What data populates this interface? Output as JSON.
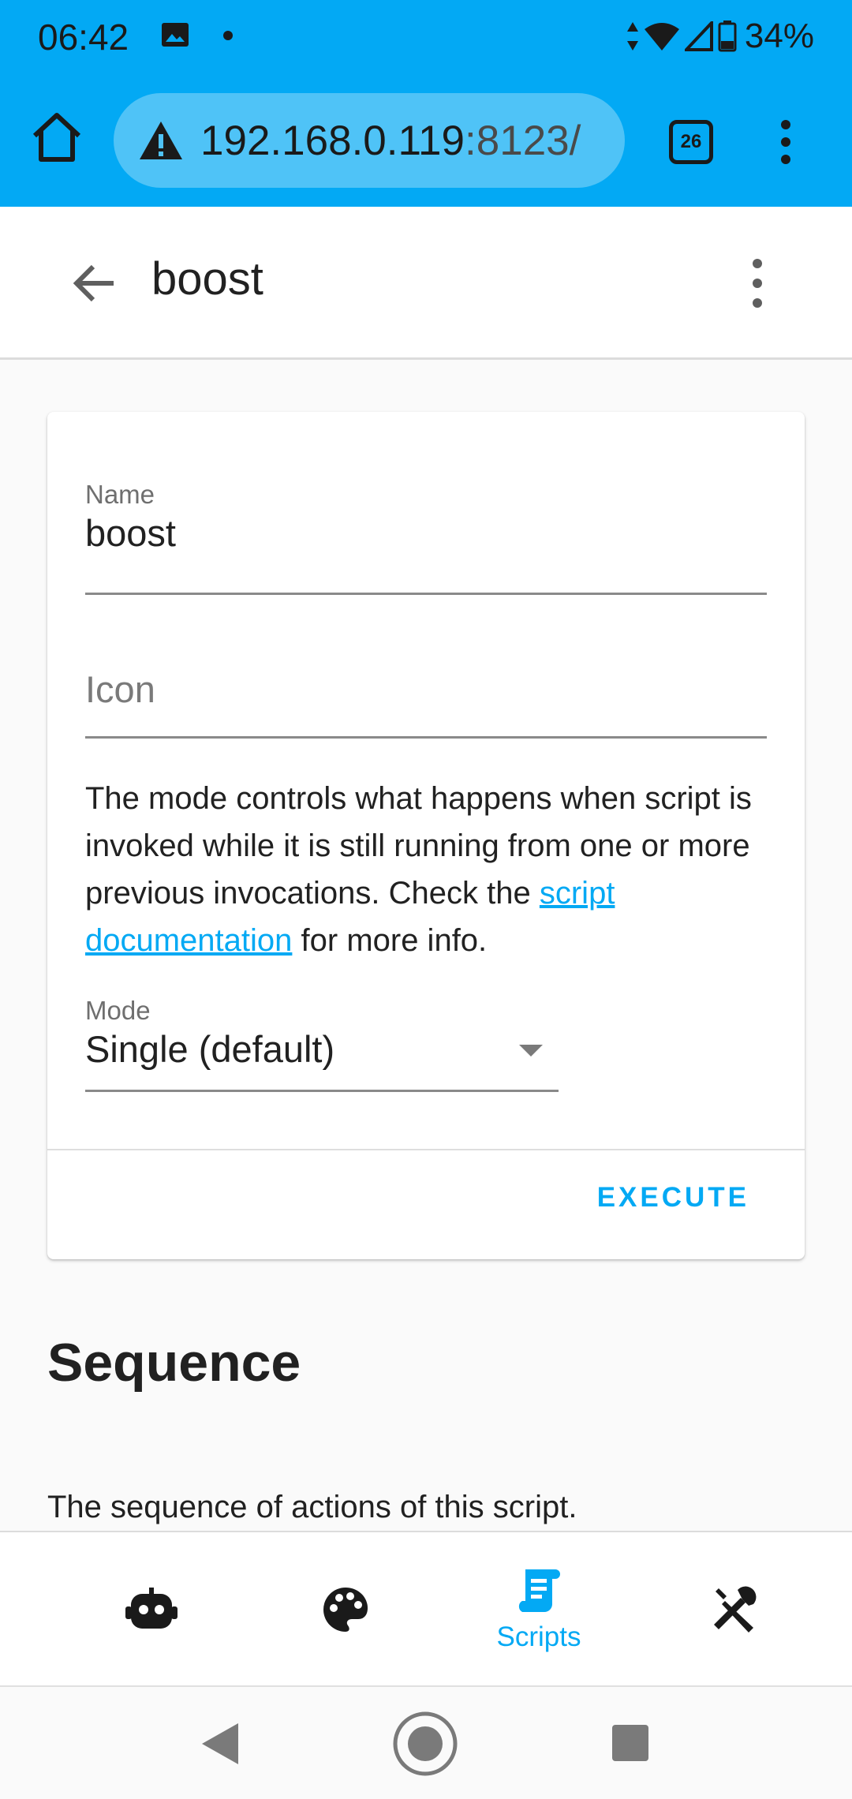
{
  "status_bar": {
    "time": "06:42",
    "battery": "34%",
    "icons": [
      "image-icon",
      "notification-dot",
      "data-arrows-icon",
      "wifi-icon",
      "signal-icon",
      "battery-icon"
    ]
  },
  "browser": {
    "url_host": "192.168.0.119",
    "url_port": ":8123/",
    "tab_count": "26",
    "icons": [
      "home-icon",
      "warning-icon",
      "tabs-icon",
      "more-vert-icon"
    ]
  },
  "header": {
    "title": "boost",
    "icons": [
      "arrow-back-icon",
      "more-vert-icon"
    ]
  },
  "card": {
    "name_label": "Name",
    "name_value": "boost",
    "icon_placeholder": "Icon",
    "mode_desc_before": "The mode controls what happens when script is invoked while it is still running from one or more previous invocations. Check the ",
    "mode_desc_link": "script documentation",
    "mode_desc_after": " for more info.",
    "mode_label": "Mode",
    "mode_value": "Single (default)",
    "execute_label": "EXECUTE"
  },
  "sequence": {
    "title": "Sequence",
    "description": "The sequence of actions of this script."
  },
  "bottom_nav": {
    "items": [
      {
        "icon": "robot-icon",
        "label": ""
      },
      {
        "icon": "palette-icon",
        "label": ""
      },
      {
        "icon": "script-icon",
        "label": "Scripts",
        "active": true
      },
      {
        "icon": "tools-icon",
        "label": ""
      }
    ]
  },
  "colors": {
    "accent": "#03a9f4",
    "chrome": "#03a9f4",
    "url_pill": "#4fc3f7"
  }
}
